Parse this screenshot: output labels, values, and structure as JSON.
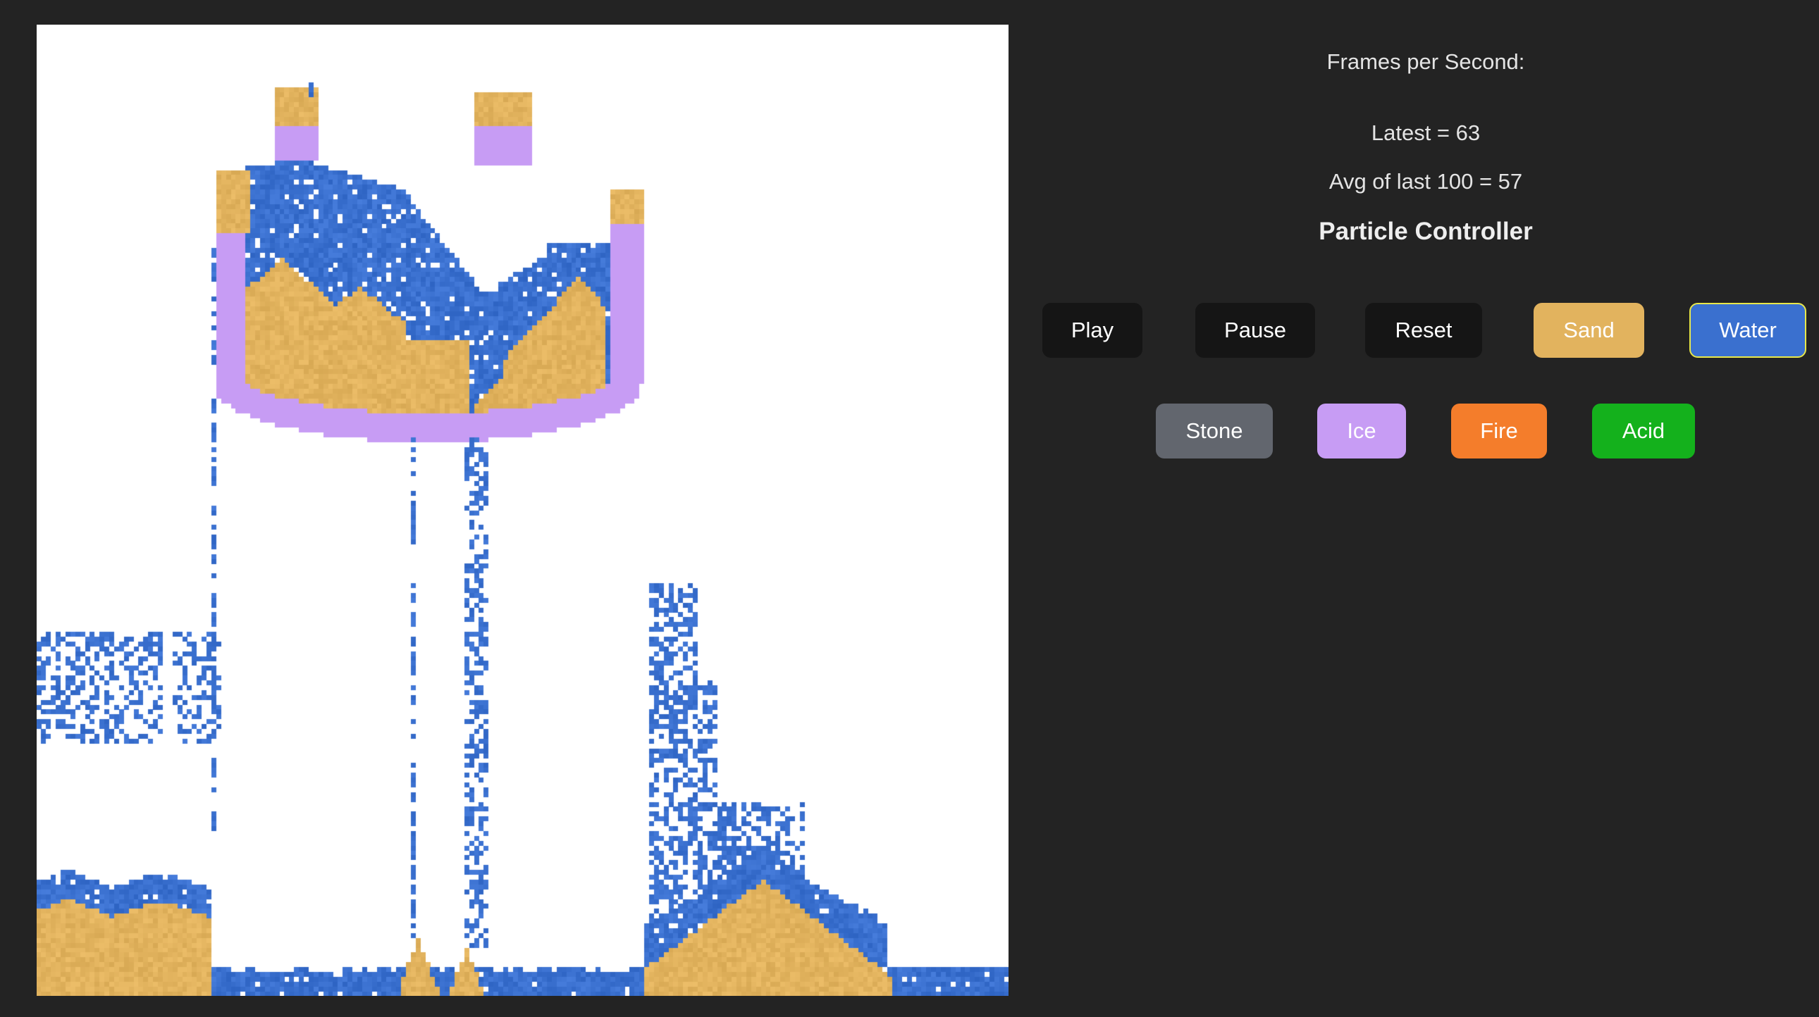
{
  "fps": {
    "heading": "Frames per Second:",
    "latest": "Latest = 63",
    "average": "Avg of last 100 = 57"
  },
  "controller": {
    "title": "Particle Controller"
  },
  "buttons": {
    "play": "Play",
    "pause": "Pause",
    "reset": "Reset",
    "sand": "Sand",
    "water": "Water",
    "stone": "Stone",
    "ice": "Ice",
    "fire": "Fire",
    "acid": "Acid"
  },
  "colors": {
    "background": "#232323",
    "canvas": "#ffffff",
    "sand": "#e2b35e",
    "water": "#3a70cf",
    "ice": "#c79cf4",
    "stone": "#62666e",
    "fire": "#f47d2b",
    "acid": "#14b11c",
    "control": "#151515",
    "selected_outline": "#e8e84a"
  },
  "selected_element": "water"
}
